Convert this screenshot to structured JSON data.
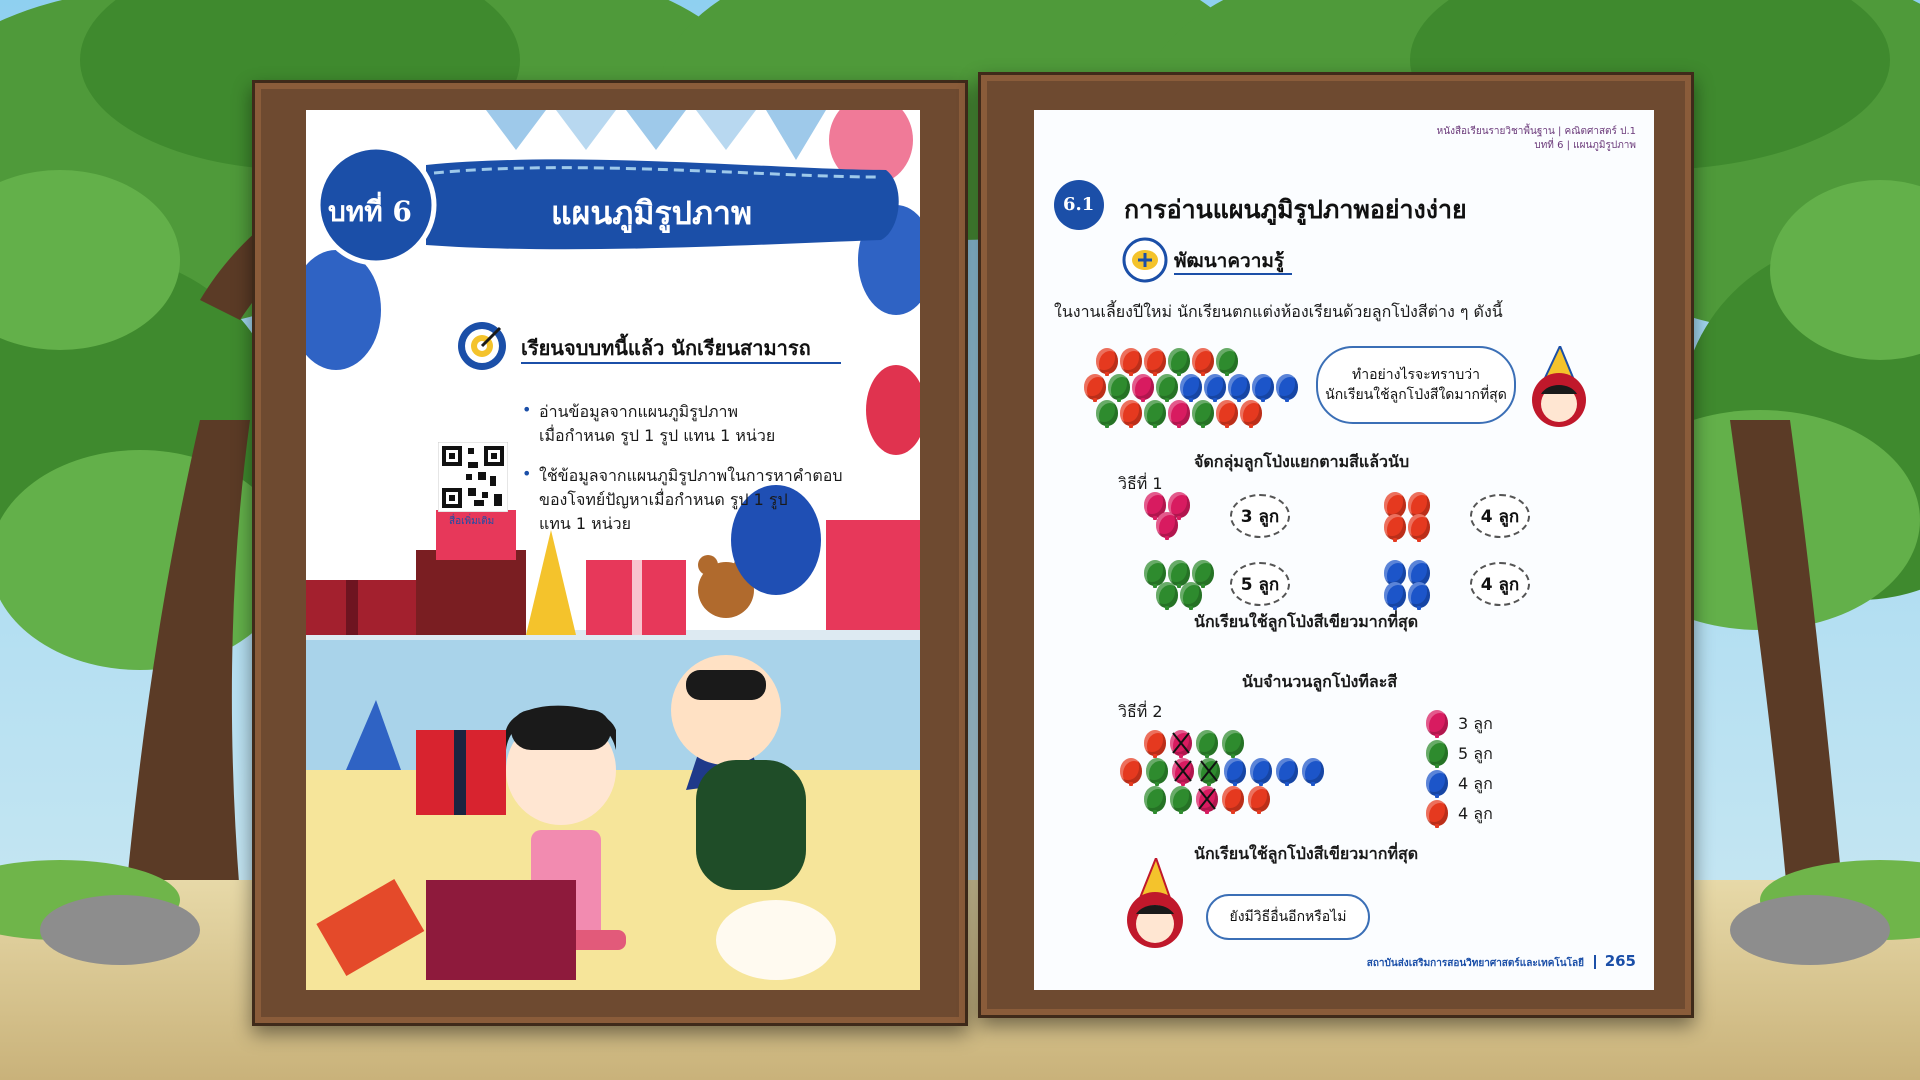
{
  "left_page": {
    "chapter_badge": "บทที่ 6",
    "chapter_title": "แผนภูมิรูปภาพ",
    "goals_heading": "เรียนจบบทนี้แล้ว นักเรียนสามารถ",
    "goals": [
      {
        "line1": "อ่านข้อมูลจากแผนภูมิรูปภาพ",
        "line2": "เมื่อกำหนด รูป 1 รูป แทน 1 หน่วย",
        "line3": ""
      },
      {
        "line1": "ใช้ข้อมูลจากแผนภูมิรูปภาพในการหาคำตอบ",
        "line2": "ของโจทย์ปัญหาเมื่อกำหนด รูป 1 รูป",
        "line3": "แทน 1 หน่วย"
      }
    ],
    "qr_caption": "สื่อเพิ่มเติม"
  },
  "right_page": {
    "header_line1": "หนังสือเรียนรายวิชาพื้นฐาน | คณิตศาสตร์ ป.1",
    "header_line2": "บทที่ 6 | แผนภูมิรูปภาพ",
    "section_number": "6.1",
    "section_title": "การอ่านแผนภูมิรูปภาพอย่างง่าย",
    "knowledge_label": "พัฒนาความรู้",
    "intro": "ในงานเลี้ยงปีใหม่ นักเรียนตกแต่งห้องเรียนด้วยลูกโป่งสีต่าง ๆ ดังนี้",
    "question_bubble_line1": "ทำอย่างไรจะทราบว่า",
    "question_bubble_line2": "นักเรียนใช้ลูกโป่งสีใดมากที่สุด",
    "method1_label": "วิธีที่ 1",
    "method1_heading": "จัดกลุ่มลูกโป่งแยกตามสีแล้วนับ",
    "method1_groups": [
      {
        "color": "#d81b60",
        "count": "3 ลูก"
      },
      {
        "color": "#e5391f",
        "count": "4 ลูก"
      },
      {
        "color": "#2e8b2e",
        "count": "5 ลูก"
      },
      {
        "color": "#1c55c9",
        "count": "4 ลูก"
      }
    ],
    "method1_result": "นักเรียนใช้ลูกโป่งสีเขียวมากที่สุด",
    "method2_label": "วิธีที่ 2",
    "method2_heading": "นับจำนวนลูกโป่งทีละสี",
    "method2_tally": [
      {
        "color": "#d81b60",
        "count": "3 ลูก"
      },
      {
        "color": "#2e8b2e",
        "count": "5 ลูก"
      },
      {
        "color": "#1c55c9",
        "count": "4 ลูก"
      },
      {
        "color": "#e5391f",
        "count": "4 ลูก"
      }
    ],
    "method2_result": "นักเรียนใช้ลูกโป่งสีเขียวมากที่สุด",
    "closing_bubble": "ยังมีวิธีอื่นอีกหรือไม่",
    "footer_org": "สถาบันส่งเสริมการสอนวิทยาศาสตร์และเทคโนโลยี",
    "page_number": "265"
  },
  "colors": {
    "title_blue": "#1b4fa8",
    "red": "#e5391f",
    "pink": "#d81b60",
    "green": "#2e8b2e",
    "blue": "#1c55c9"
  }
}
